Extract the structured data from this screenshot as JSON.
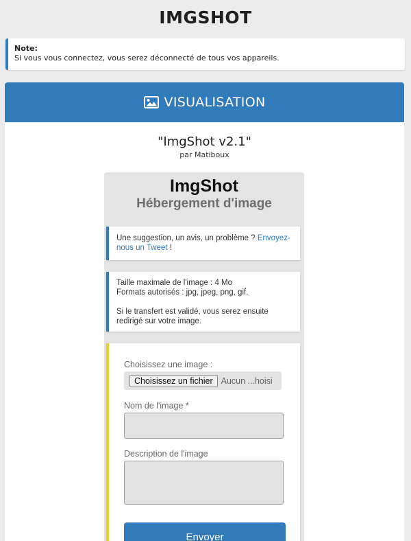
{
  "site": {
    "title": "IMGSHOT"
  },
  "note": {
    "label": "Note:",
    "text": "Si vous vous connectez, vous serez déconnecté de tous vos appareils."
  },
  "panel": {
    "icon": "image-icon",
    "header": "VISUALISATION",
    "preview_title": "\"ImgShot v2.1\"",
    "preview_author": "par Matiboux"
  },
  "preview": {
    "title": "ImgShot",
    "subtitle": "Hébergement d'image",
    "suggestion_text": "Une suggestion, un avis, un problème ? ",
    "suggestion_link": "Envoyez-nous un Tweet",
    "suggestion_end": " !",
    "info": {
      "max_size": "Taille maximale de l'image : 4 Mo",
      "formats": "Formats autorisés : jpg, jpeg, png, gif.",
      "redirect": "Si le transfert est validé, vous serez ensuite redirigé sur votre image."
    },
    "form": {
      "choose_label": "Choisissez une image :",
      "file_button": "Choisissez un fichier",
      "file_status": "Aucun ...hoisi",
      "name_label": "Nom de l'image *",
      "name_value": "",
      "description_label": "Description de l'image",
      "description_value": "",
      "submit_label": "Envoyer"
    }
  },
  "colors": {
    "accent": "#317bbb",
    "note_border": "#2f7ec0",
    "form_border": "#f0cf23",
    "page_bg": "#ececec"
  }
}
